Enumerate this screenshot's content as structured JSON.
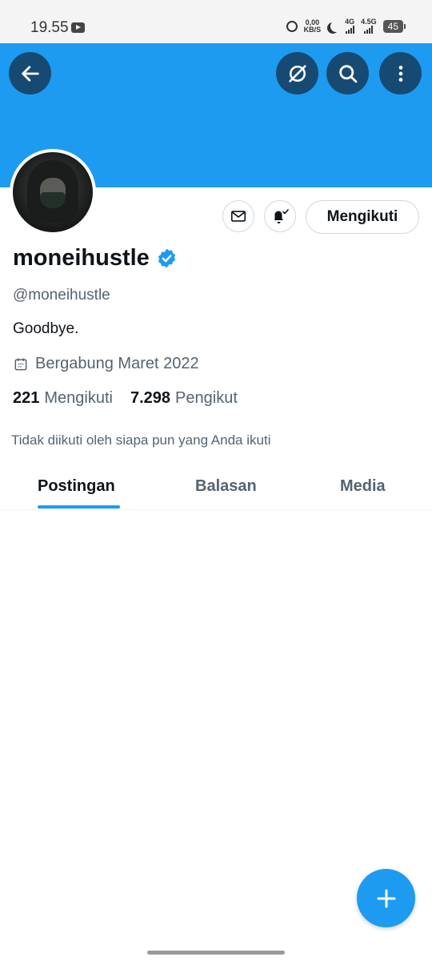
{
  "status_bar": {
    "time": "19.55",
    "speed_value": "0,00",
    "speed_unit": "KB/S",
    "net1": "4G",
    "net2": "4.5G",
    "battery": "45"
  },
  "profile": {
    "name": "moneihustle",
    "handle": "@moneihustle",
    "bio": "Goodbye.",
    "joined": "Bergabung Maret 2022",
    "following_count": "221",
    "following_label": "Mengikuti",
    "followers_count": "7.298",
    "followers_label": "Pengikut",
    "followed_by_note": "Tidak diikuti oleh siapa pun yang Anda ikuti",
    "verified": true
  },
  "actions": {
    "follow_button_label": "Mengikuti"
  },
  "tabs": [
    {
      "label": "Postingan",
      "active": true
    },
    {
      "label": "Balasan",
      "active": false
    },
    {
      "label": "Media",
      "active": false
    }
  ],
  "colors": {
    "accent": "#1d9bf0",
    "banner_button": "#174a73"
  },
  "icons": [
    "back-arrow-icon",
    "grok-icon",
    "search-icon",
    "more-vertical-icon",
    "mail-icon",
    "bell-check-icon",
    "calendar-icon",
    "verified-badge-icon",
    "plus-icon"
  ]
}
